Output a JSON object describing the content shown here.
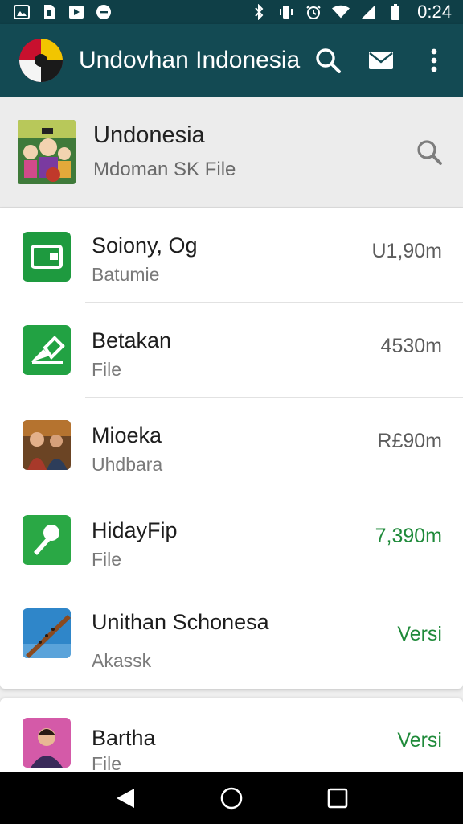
{
  "status_bar": {
    "time": "0:24",
    "left_icons": [
      "gallery-notification-icon",
      "sim-notification-icon",
      "media-notification-icon",
      "chat-notification-icon"
    ],
    "right_icons": [
      "bluetooth-icon",
      "vibrate-icon",
      "alarm-icon",
      "wifi-icon",
      "signal-icon",
      "battery-icon"
    ]
  },
  "app_bar": {
    "title": "Undovhan Indonesia",
    "actions": [
      "search-icon",
      "mail-icon",
      "more-vert-icon"
    ]
  },
  "header": {
    "title": "Undonesia",
    "subtitle": "Mdoman SK File"
  },
  "list": [
    {
      "title": "Soiony, Og",
      "subtitle": "Batumie",
      "meta": "U1,90m",
      "meta_color": "#5c5c5c",
      "icon": "wallet-app-icon",
      "icon_color": "#1e9a3f"
    },
    {
      "title": "Betakan",
      "subtitle": "File",
      "meta": "4530m",
      "meta_color": "#5c5c5c",
      "icon": "edit-app-icon",
      "icon_color": "#22a243"
    },
    {
      "title": "Mioeka",
      "subtitle": "Uhdbara",
      "meta": "R£90m",
      "meta_color": "#5c5c5c",
      "icon": "photo-thumbnail-icon",
      "icon_color": "#8a5a2a"
    },
    {
      "title": "HidayFip",
      "subtitle": "File",
      "meta": "7,390m",
      "meta_color": "#1f8a3a",
      "icon": "pin-app-icon",
      "icon_color": "#2aa845"
    },
    {
      "title": "Unithan Schonesa",
      "subtitle": "Akassk",
      "meta": "Versi",
      "meta_color": "#1f8a3a",
      "icon": "flute-thumbnail-icon",
      "icon_color": "#2f86c9"
    }
  ],
  "list2": [
    {
      "title": "Bartha",
      "subtitle": "File",
      "meta": "Versi",
      "meta_color": "#1f8a3a",
      "icon": "person-thumbnail-icon",
      "icon_color": "#d45aa8"
    }
  ],
  "nav_bar": [
    "back-icon",
    "home-icon",
    "recents-icon"
  ]
}
